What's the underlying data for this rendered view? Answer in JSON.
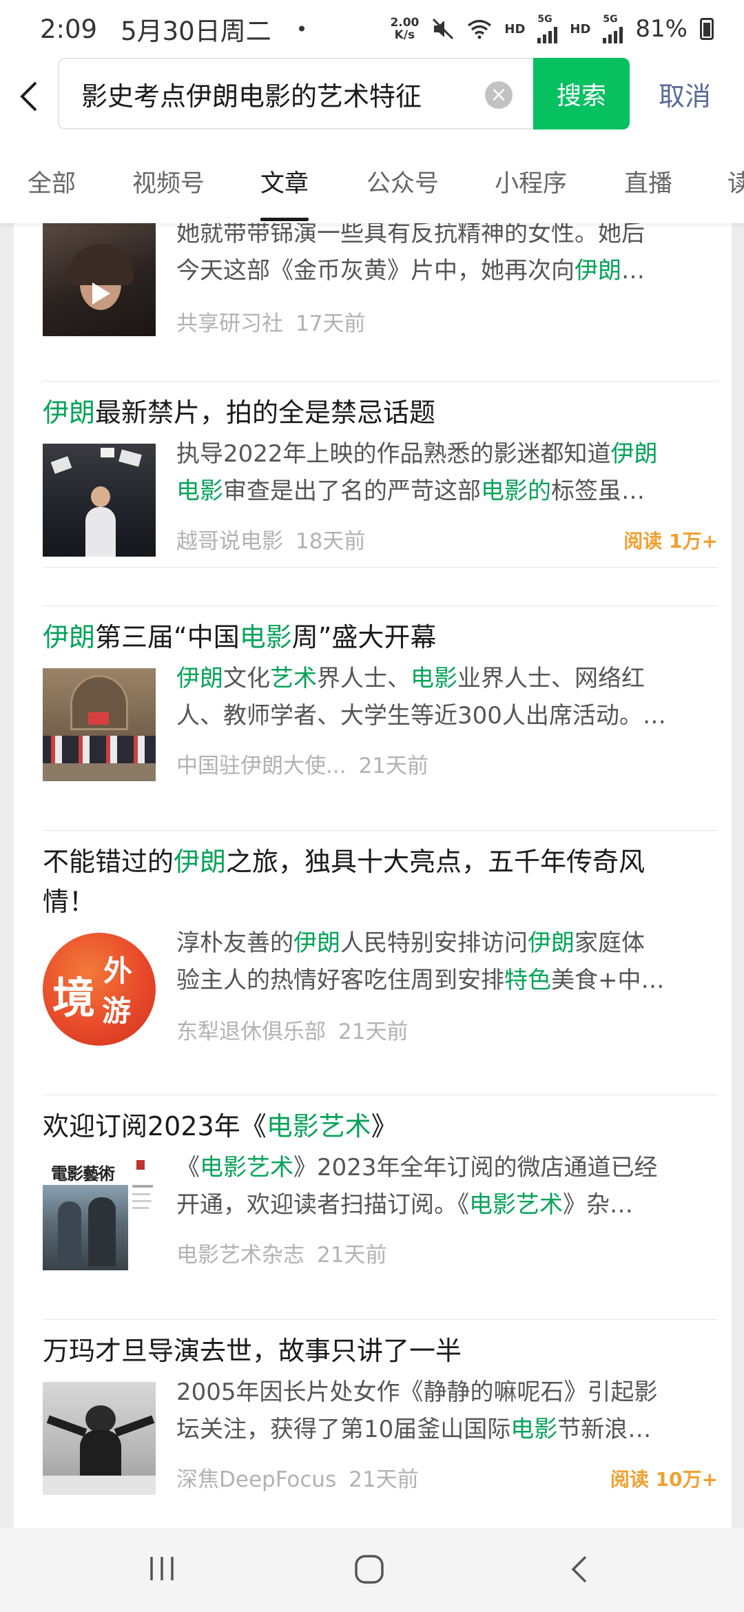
{
  "status_bar": {
    "time": "2:09",
    "date": "5月30日周二",
    "dot": "•",
    "net_speed_value": "2.00",
    "net_speed_unit": "K/s",
    "hd1": "HD",
    "net1": "5G",
    "hd2": "HD",
    "net2": "5G",
    "battery": "81%"
  },
  "search": {
    "query": "影史考点伊朗电影的艺术特征",
    "search_label": "搜索",
    "cancel_label": "取消"
  },
  "tabs": [
    {
      "label": "全部"
    },
    {
      "label": "视频号"
    },
    {
      "label": "文章",
      "active": true
    },
    {
      "label": "公众号"
    },
    {
      "label": "小程序"
    },
    {
      "label": "直播"
    },
    {
      "label": "读"
    }
  ],
  "articles": [
    {
      "desc_line1": "她就带带铞演一些具有反抗精神的女性。她后",
      "desc_line2_parts": [
        "今天这部《金币灰黄》片中，她再次向",
        "伊朗",
        "…"
      ],
      "source": "共享研习社",
      "time": "17天前"
    },
    {
      "title_parts": [
        "伊朗",
        "最新禁片，拍的全是禁忌话题"
      ],
      "desc_line1_parts": [
        "执导2022年上映的作品熟悉的影迷都知道",
        "伊朗"
      ],
      "desc_line2_parts": [
        "电影",
        "审查是出了名的严苛这部",
        "电影的",
        "标签虽…"
      ],
      "source": "越哥说电影",
      "time": "18天前",
      "read": "阅读 1万+"
    },
    {
      "title_parts": [
        "伊朗",
        "第三届“中国",
        "电影",
        "周”盛大开幕"
      ],
      "desc_line1_parts": [
        "伊朗",
        "文化",
        "艺术",
        "界人士、",
        "电影",
        "业界人士、网络红"
      ],
      "desc_line2": "人、教师学者、大学生等近300人出席活动。…",
      "source": "中国驻伊朗大使...",
      "time": "21天前"
    },
    {
      "title_line1_parts": [
        "不能错过的",
        "伊朗",
        "之旅，独具十大亮点，五千年传奇风"
      ],
      "title_line2": "情！",
      "desc_line1_parts": [
        "淳朴友善的",
        "伊朗",
        "人民特别安排访问",
        "伊朗",
        "家庭体"
      ],
      "desc_line2_parts": [
        "验主人的热情好客吃住周到安排",
        "特色",
        "美食+中…"
      ],
      "source": "东犁退休俱乐部",
      "time": "21天前",
      "logo_text_1": "境",
      "logo_text_2": "外",
      "logo_text_3": "游"
    },
    {
      "title_parts": [
        "欢迎订阅2023年《",
        "电影艺术",
        "》"
      ],
      "desc_line1_parts": [
        "《",
        "电影艺术",
        "》2023年全年订阅的微店通道已经"
      ],
      "desc_line2_parts": [
        "开通，欢迎读者扫描订阅。《",
        "电影艺术",
        "》杂…"
      ],
      "source": "电影艺术杂志",
      "time": "21天前",
      "cover_text": "電影藝術"
    },
    {
      "title": "万玛才旦导演去世，故事只讲了一半",
      "desc_line1": "2005年因长片处女作《静静的嘛呢石》引起影",
      "desc_line2_parts": [
        "坛关注，获得了第10届釜山国际",
        "电影",
        "节新浪…"
      ],
      "source": "深焦DeepFocus",
      "time": "21天前",
      "read": "阅读 10万+"
    }
  ],
  "colors": {
    "accent_green": "#07c160",
    "highlight_green": "#07a35a",
    "link_blue": "#576b95",
    "read_orange": "#f0a030"
  }
}
